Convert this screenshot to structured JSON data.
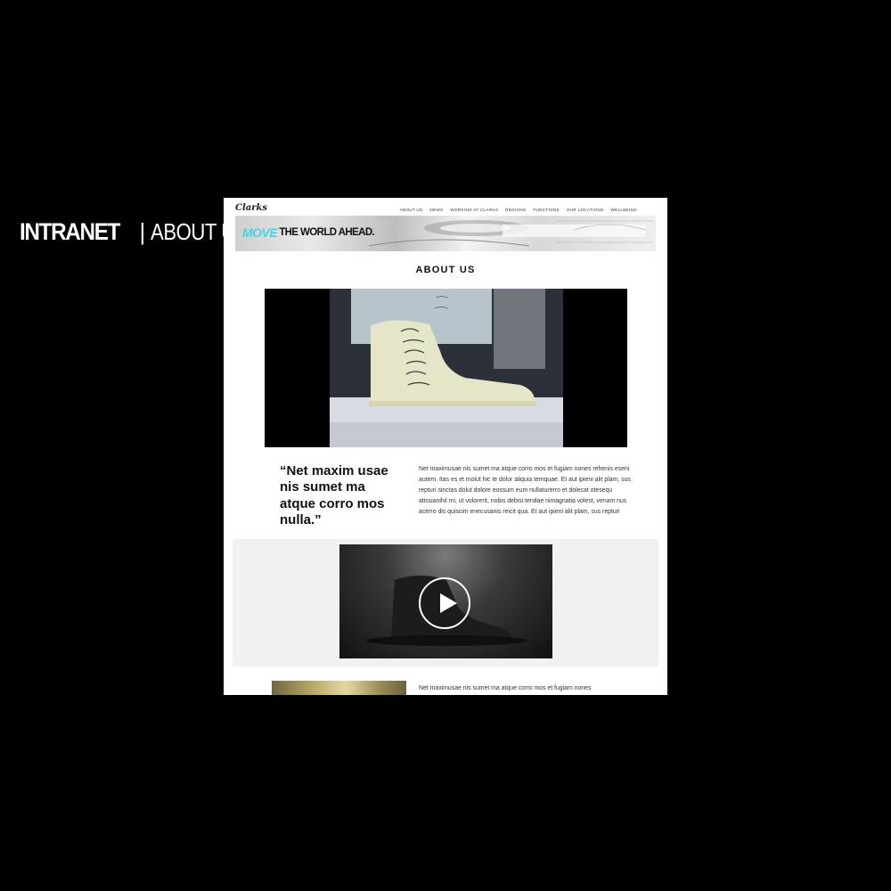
{
  "heading": {
    "strong": "INTRANET",
    "separator": "|",
    "light": "ABOUT US"
  },
  "site": {
    "logo": "Clarks",
    "menu": [
      "ABOUT US",
      "NEWS",
      "WORKING AT CLARKS",
      "REGIONS",
      "FUNCTIONS",
      "OUR LOCATIONS",
      "WELLBEING"
    ]
  },
  "banner": {
    "move": "MOVE",
    "rest": "THE WORLD AHEAD."
  },
  "page": {
    "title": "ABOUT US"
  },
  "content": {
    "quote": "“Net maxim usae nis sumet ma atque corro mos nulla.”",
    "paragraph": "Net maximusae nis sumet ma atque corro mos et fugiam nones rehenis eseni autem. Itas es et molut hic te dolor aliquia temquae. Et aut ipieni alit plam, sus repturi sinctas dolut dolore eossum eum nullaturerro et dolecat otesequ atissianihil mi, ut volorerit, nobis debisi tendae nimagnatia volest, venam nus acerro dis quiscim enecusanis reicit qua. Et aut ipieni alit plam, sus repturi",
    "bottom_paragraph": "Net maximusae nis sumet ma atque corro mos et fugiam nones"
  },
  "colors": {
    "accent_move": "#3fd6e6",
    "background": "#000000",
    "page": "#ffffff",
    "video_band": "#f1f1f1"
  },
  "icons": {
    "play": "play-icon"
  }
}
